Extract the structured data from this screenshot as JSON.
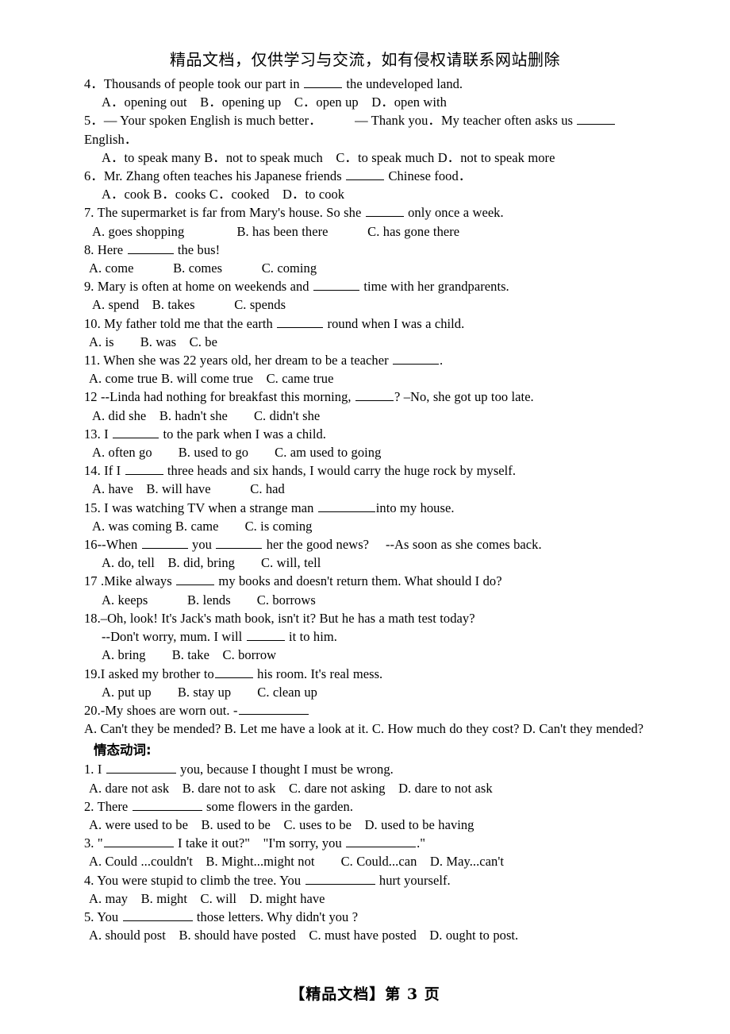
{
  "header": {
    "text": "精品文档，仅供学习与交流，如有侵权请联系网站删除"
  },
  "footer": {
    "text": "【精品文档】第 3 页",
    "page_number": "3"
  },
  "section_heading": "情态动词:",
  "questions": [
    {
      "number": "4．",
      "stem_before": "Thousands of people took our part in ",
      "blank": "b-md",
      "stem_after": " the undeveloped land.",
      "options": "A．opening out　B．opening up　C．open up　D．open with"
    },
    {
      "number": "5．",
      "stem_before": "― Your spoken English is much better．　　　― Thank you．My teacher often asks us ",
      "blank": "b-md",
      "stem_after": "",
      "wrap_line": "English．",
      "options": "A．to speak many B．not to speak much　C．to speak much D．not to speak more"
    },
    {
      "number": "6．",
      "stem_before": "Mr. Zhang often teaches his Japanese friends ",
      "blank": "b-md",
      "stem_after": " Chinese food．",
      "options": "A．cook B．cooks C．cooked　D．to cook"
    },
    {
      "number": "7. ",
      "stem_before": "The supermarket is far from Mary's house. So she ",
      "blank": "b-md",
      "stem_after": " only once a week.",
      "options": "A. goes shopping　　　　B. has been there　　　C. has gone there"
    },
    {
      "number": "8. ",
      "stem_before": "Here ",
      "blank": "b-lg",
      "stem_after": " the bus!",
      "options": "A. come　　　B. comes　　　C. coming"
    },
    {
      "number": "9. ",
      "stem_before": "Mary is often at home on weekends and ",
      "blank": "b-lg",
      "stem_after": " time with her grandparents.",
      "options": "A. spend　B. takes　　　C. spends"
    },
    {
      "number": "10. ",
      "stem_before": "My father told me that the earth ",
      "blank": "b-lg",
      "stem_after": " round when I was a child.",
      "options": "A. is　　B. was　C. be"
    },
    {
      "number": "11. ",
      "stem_before": "When she was 22 years old, her dream to be a teacher ",
      "blank": "b-lg",
      "stem_after": ".",
      "options": "A. come true B. will come true　C. came true"
    },
    {
      "number": "12 ",
      "stem_before": "--Linda had nothing for breakfast this morning, ",
      "blank": "b-md",
      "stem_after": "? –No, she got up too late.",
      "options": "A. did she　B. hadn't she　　C. didn't she"
    },
    {
      "number": "13. ",
      "stem_before": "I ",
      "blank": "b-lg",
      "stem_after": " to the park when I was a child.",
      "options": "A. often go　　B. used to go　　C. am used to going"
    },
    {
      "number": "14. ",
      "stem_before": "If I ",
      "blank": "b-md",
      "stem_after": " three heads and six hands, I would carry the huge rock by myself.",
      "options": "A. have　B. will have　　　C. had"
    },
    {
      "number": "15. ",
      "stem_before": "I was watching TV when a strange man ",
      "blank": "b-xl",
      "stem_after": "into my house.",
      "options": "A. was coming B. came　　C. is coming"
    },
    {
      "number": "16",
      "stem_before": "--When ",
      "blank": "b-lg",
      "stem_mid": " you ",
      "blank2": "b-lg",
      "stem_after": " her the good news?　 --As soon as she comes back.",
      "options": "A. do, tell　B. did, bring　　C. will, tell"
    },
    {
      "number": "17 ",
      "stem_before": ".Mike always ",
      "blank": "b-md",
      "stem_after": " my books and doesn't return them. What should I do?",
      "options": "A. keeps　　　B. lends　　C. borrows"
    },
    {
      "number": "18.",
      "stem_before": "–Oh, look! It's Jack's math book, isn't it? But he has a math test today?",
      "blank": "",
      "stem_after": "",
      "sub_line_before": "--Don't worry, mum. I will ",
      "sub_blank": "b-md",
      "sub_line_after": " it to him.",
      "options": "A. bring　　B. take　C. borrow"
    },
    {
      "number": "19.",
      "stem_before": "I asked my brother to",
      "blank": "b-md",
      "stem_after": " his room. It's real mess.",
      "options": "A. put up　　B. stay up　　C. clean up"
    },
    {
      "number": "20.",
      "stem_before": "-My shoes are worn out. -",
      "blank": "b-xxl",
      "stem_after": "",
      "options": "A. Can't they be mended? B. Let me have a look at it. C. How much do they cost? D. Can't they mended?"
    }
  ],
  "modal_questions": [
    {
      "number": "1. ",
      "stem_before": "I ",
      "blank": "b-xxl",
      "stem_after": " you, because I thought I must be wrong.",
      "options": "A. dare not ask　B. dare not to ask　C. dare not asking　D. dare to not ask"
    },
    {
      "number": "2. ",
      "stem_before": "There ",
      "blank": "b-xxl",
      "stem_after": " some flowers in the garden.",
      "options": "A. were used to be　B. used to be　C. uses to be　D. used to be having"
    },
    {
      "number": "3. ",
      "stem_before": "\"",
      "blank": "b-xxl",
      "stem_mid": " I take it out?\"　\"I'm sorry, you ",
      "blank2": "b-xxl",
      "stem_after": ".\"",
      "options": "A. Could ...couldn't　B. Might...might not　　C. Could...can　D. May...can't"
    },
    {
      "number": "4. ",
      "stem_before": "You were stupid to climb the tree. You ",
      "blank": "b-xxl",
      "stem_after": " hurt yourself.",
      "options": "A. may　B. might　C. will　D. might have"
    },
    {
      "number": "5. ",
      "stem_before": "You ",
      "blank": "b-xxl",
      "stem_after": " those letters. Why didn't you ?",
      "options": "A. should post　B. should have posted　C. must have posted　D. ought to post."
    }
  ]
}
